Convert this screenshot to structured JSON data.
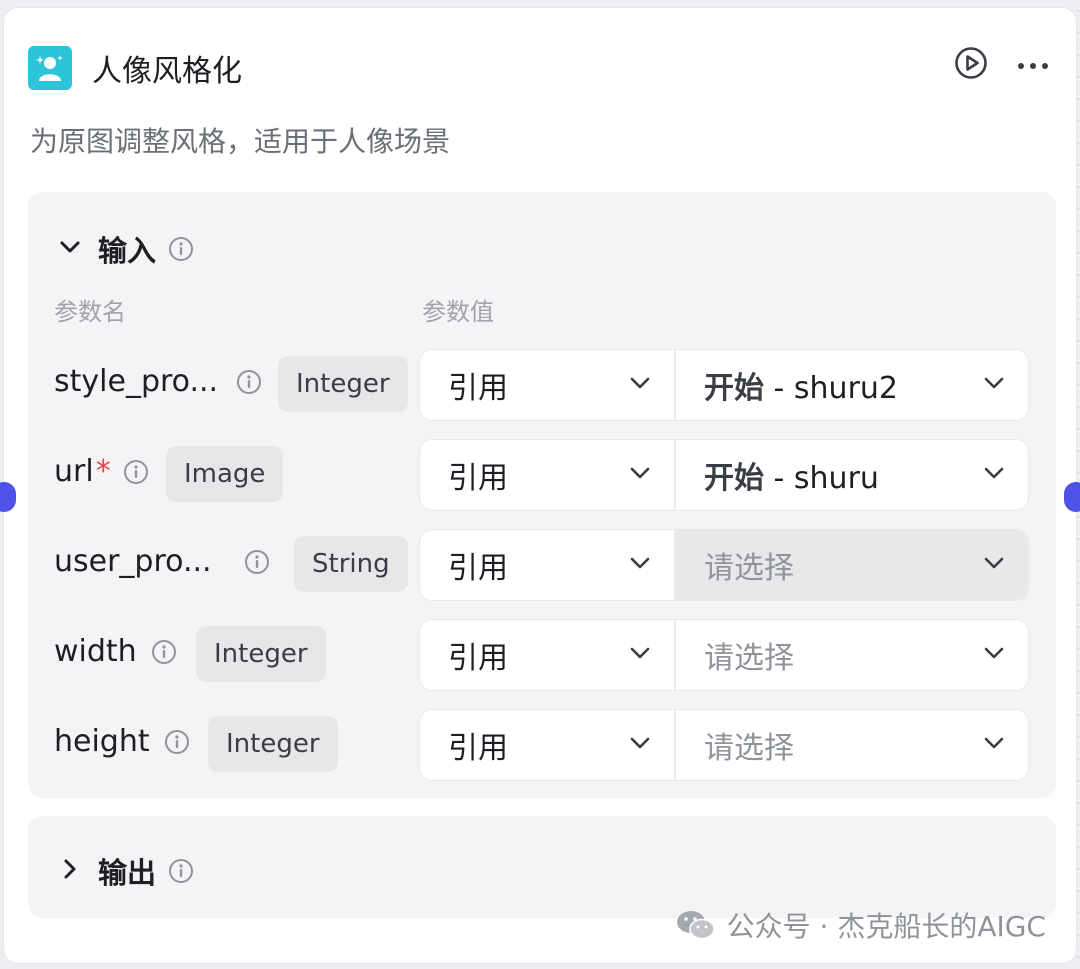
{
  "node": {
    "title": "人像风格化",
    "description": "为原图调整风格，适用于人像场景",
    "icons": {
      "app": "portrait-sparkle-icon",
      "run": "play-circle-icon",
      "more": "more-horizontal-icon"
    }
  },
  "inputs": {
    "title": "输入",
    "col_name": "参数名",
    "col_value": "参数值",
    "params": [
      {
        "name": "style_pro...",
        "required": "",
        "type": "Integer",
        "mode": "引用",
        "ref_node": "开始",
        "ref_sep": " - ",
        "ref_var": "shuru2",
        "placeholder": ""
      },
      {
        "name": "url",
        "required": "*",
        "type": "Image",
        "mode": "引用",
        "ref_node": "开始",
        "ref_sep": " - ",
        "ref_var": "shuru",
        "placeholder": ""
      },
      {
        "name": "user_pro...",
        "required": "",
        "type": "String",
        "mode": "引用",
        "ref_node": "",
        "ref_sep": "",
        "ref_var": "",
        "placeholder": "请选择"
      },
      {
        "name": "width",
        "required": "",
        "type": "Integer",
        "mode": "引用",
        "ref_node": "",
        "ref_sep": "",
        "ref_var": "",
        "placeholder": "请选择"
      },
      {
        "name": "height",
        "required": "",
        "type": "Integer",
        "mode": "引用",
        "ref_node": "",
        "ref_sep": "",
        "ref_var": "",
        "placeholder": "请选择"
      }
    ]
  },
  "outputs": {
    "title": "输出"
  },
  "watermark": {
    "text": "公众号 · 杰克船长的AIGC",
    "icon": "wechat-icon"
  },
  "colors": {
    "accent": "#4d53e8",
    "app_icon": "#2bc4d9",
    "required": "#f0413e"
  }
}
